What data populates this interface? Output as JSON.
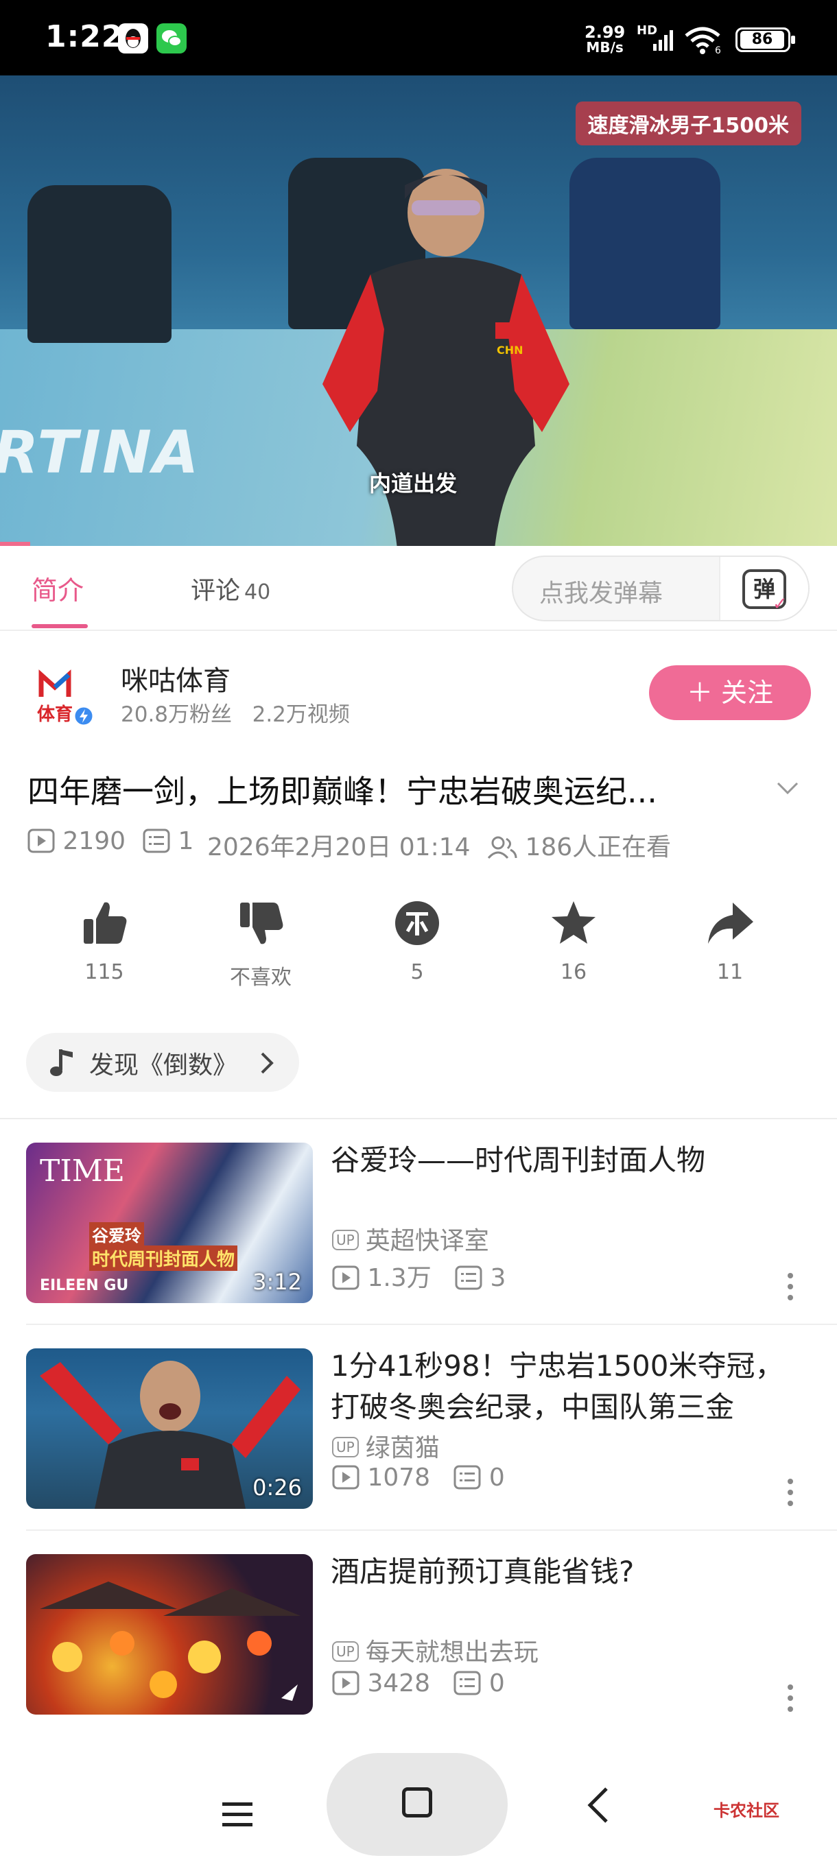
{
  "status_bar": {
    "time": "1:22",
    "speed_value": "2.99",
    "speed_unit": "MB/s",
    "network": "HD",
    "network_gen": "6",
    "battery": "86"
  },
  "video": {
    "corner_tag": "速度滑冰男子1500米",
    "subtitle": "内道出发",
    "background_text": "RTINA",
    "progress_fraction": 0.036
  },
  "tabs": {
    "intro": "简介",
    "comments": "评论",
    "comments_count": "40",
    "danmu_placeholder": "点我发弹幕",
    "danmu_icon_char": "弹"
  },
  "channel": {
    "name": "咪咕体育",
    "fans": "20.8万粉丝",
    "videos": "2.2万视频",
    "follow_label": "＋ 关注",
    "logo_text": "体育"
  },
  "video_info": {
    "title": "四年磨一剑，上场即巅峰！宁忠岩破奥运纪...",
    "plays": "2190",
    "danmaku": "1",
    "datetime": "2026年2月20日 01:14",
    "watching": "186人正在看"
  },
  "actions": {
    "like": "115",
    "dislike": "不喜欢",
    "coin": "5",
    "favorite": "16",
    "share": "11"
  },
  "music": {
    "label": "发现《倒数》"
  },
  "related": [
    {
      "title": "谷爱玲——时代周刊封面人物",
      "uploader": "英超快译室",
      "plays": "1.3万",
      "danmaku": "3",
      "duration": "3:12",
      "thumb_text_top": "TIME",
      "thumb_text_a": "谷爱玲",
      "thumb_text_b": "时代周刊封面人物",
      "thumb_text_c": "EILEEN GU"
    },
    {
      "title": "1分41秒98！宁忠岩1500米夺冠，打破冬奥会纪录，中国队第三金",
      "uploader": "绿茵猫",
      "plays": "1078",
      "danmaku": "0",
      "duration": "0:26"
    },
    {
      "title": "酒店提前预订真能省钱?",
      "uploader": "每天就想出去玩",
      "plays": "3428",
      "danmaku": "0",
      "duration": ""
    }
  ],
  "up_badge": "UP",
  "watermark": "卡农社区",
  "colors": {
    "accent": "#e8598a",
    "follow_bg": "#f06b96"
  }
}
